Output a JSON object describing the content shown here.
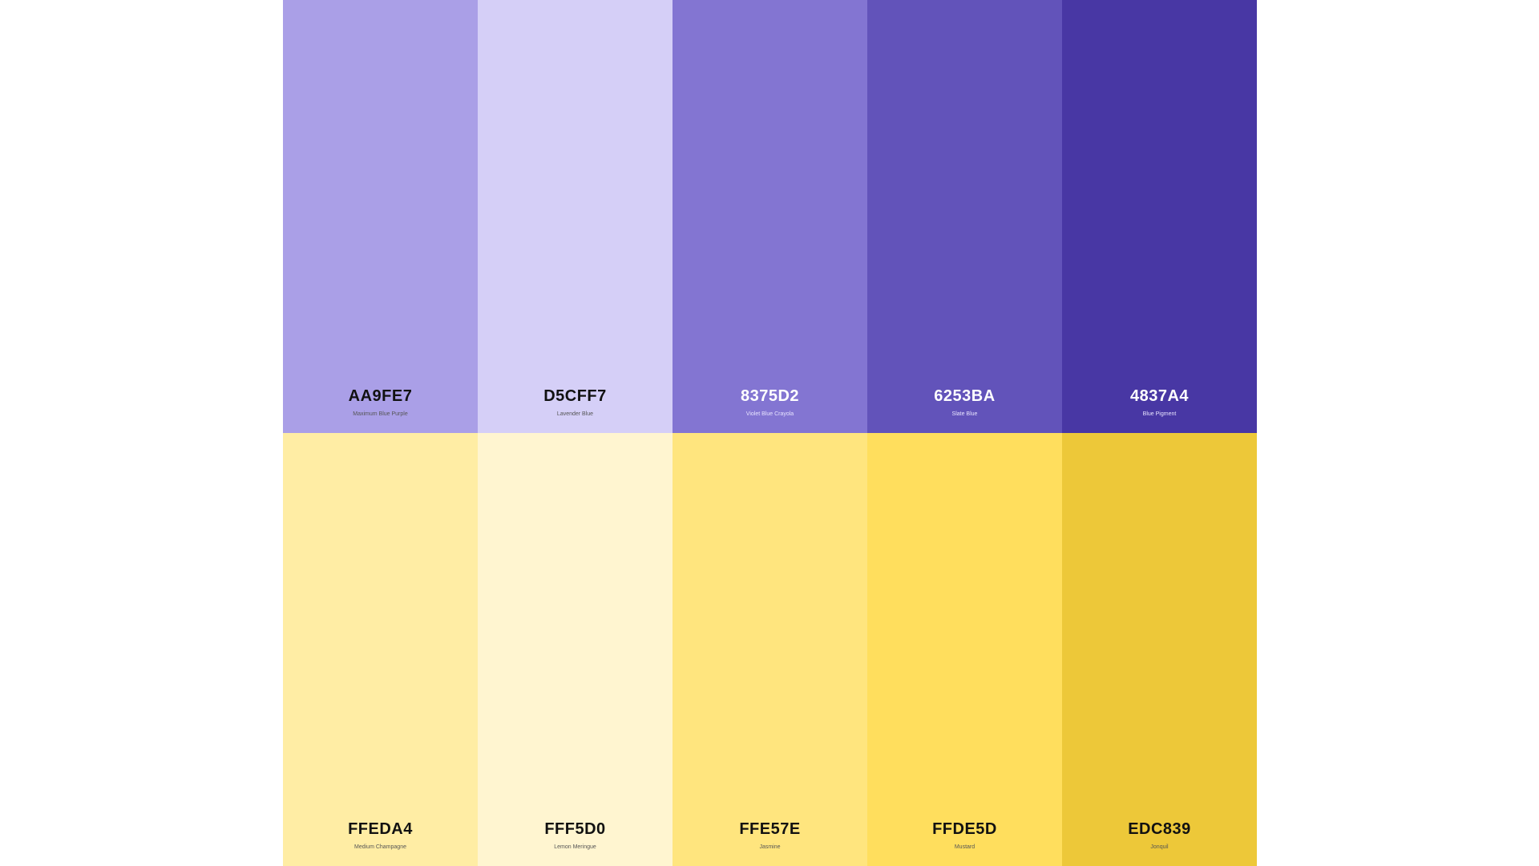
{
  "palette": {
    "rows": [
      {
        "swatches": [
          {
            "hex": "AA9FE7",
            "name": "Maximum Blue Purple",
            "color": "#AA9FE7",
            "text_tone": "dark"
          },
          {
            "hex": "D5CFF7",
            "name": "Lavender Blue",
            "color": "#D5CFF7",
            "text_tone": "dark"
          },
          {
            "hex": "8375D2",
            "name": "Violet Blue Crayola",
            "color": "#8375D2",
            "text_tone": "light"
          },
          {
            "hex": "6253BA",
            "name": "Slate Blue",
            "color": "#6253BA",
            "text_tone": "light"
          },
          {
            "hex": "4837A4",
            "name": "Blue Pigment",
            "color": "#4837A4",
            "text_tone": "light"
          }
        ]
      },
      {
        "swatches": [
          {
            "hex": "FFEDA4",
            "name": "Medium Champagne",
            "color": "#FFEDA4",
            "text_tone": "dark"
          },
          {
            "hex": "FFF5D0",
            "name": "Lemon Meringue",
            "color": "#FFF5D0",
            "text_tone": "dark"
          },
          {
            "hex": "FFE57E",
            "name": "Jasmine",
            "color": "#FFE57E",
            "text_tone": "dark"
          },
          {
            "hex": "FFDE5D",
            "name": "Mustard",
            "color": "#FFDE5D",
            "text_tone": "dark"
          },
          {
            "hex": "EDC839",
            "name": "Jonquil",
            "color": "#EDC839",
            "text_tone": "dark"
          }
        ]
      }
    ]
  }
}
